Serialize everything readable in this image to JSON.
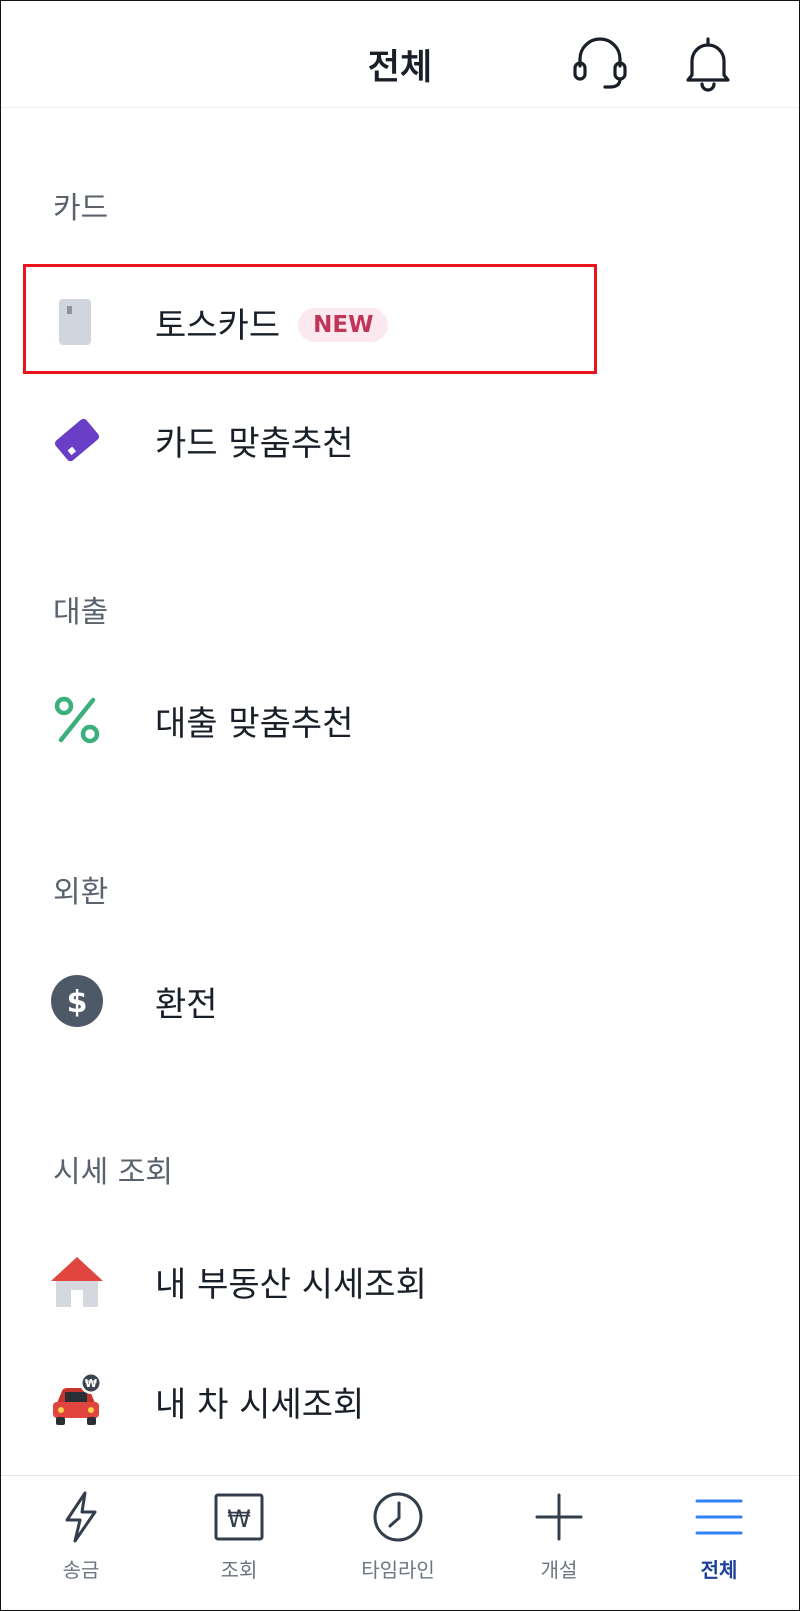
{
  "header": {
    "title": "전체",
    "support_icon": "headset-icon",
    "notification_icon": "bell-icon"
  },
  "sections": [
    {
      "title": "카드",
      "items": [
        {
          "label": "토스카드",
          "badge": "NEW",
          "icon": "card-icon",
          "highlighted": true
        },
        {
          "label": "카드 맞춤추천",
          "icon": "purple-card-icon"
        }
      ]
    },
    {
      "title": "대출",
      "items": [
        {
          "label": "대출 맞춤추천",
          "icon": "percent-icon"
        }
      ]
    },
    {
      "title": "외환",
      "items": [
        {
          "label": "환전",
          "icon": "dollar-coin-icon"
        }
      ]
    },
    {
      "title": "시세 조회",
      "items": [
        {
          "label": "내 부동산 시세조회",
          "icon": "house-icon"
        },
        {
          "label": "내 차 시세조회",
          "icon": "car-won-icon"
        }
      ]
    }
  ],
  "tabbar": {
    "items": [
      {
        "label": "송금",
        "icon": "lightning-icon"
      },
      {
        "label": "조회",
        "icon": "won-receipt-icon"
      },
      {
        "label": "타임라인",
        "icon": "clock-icon"
      },
      {
        "label": "개설",
        "icon": "plus-icon"
      },
      {
        "label": "전체",
        "icon": "menu-icon",
        "active": true
      }
    ]
  },
  "colors": {
    "accent": "#1b3f9a",
    "active_tab_icon": "#3182f6",
    "badge_bg": "#fbe9ef",
    "badge_text": "#c0355a",
    "highlight": "#e8131b"
  }
}
